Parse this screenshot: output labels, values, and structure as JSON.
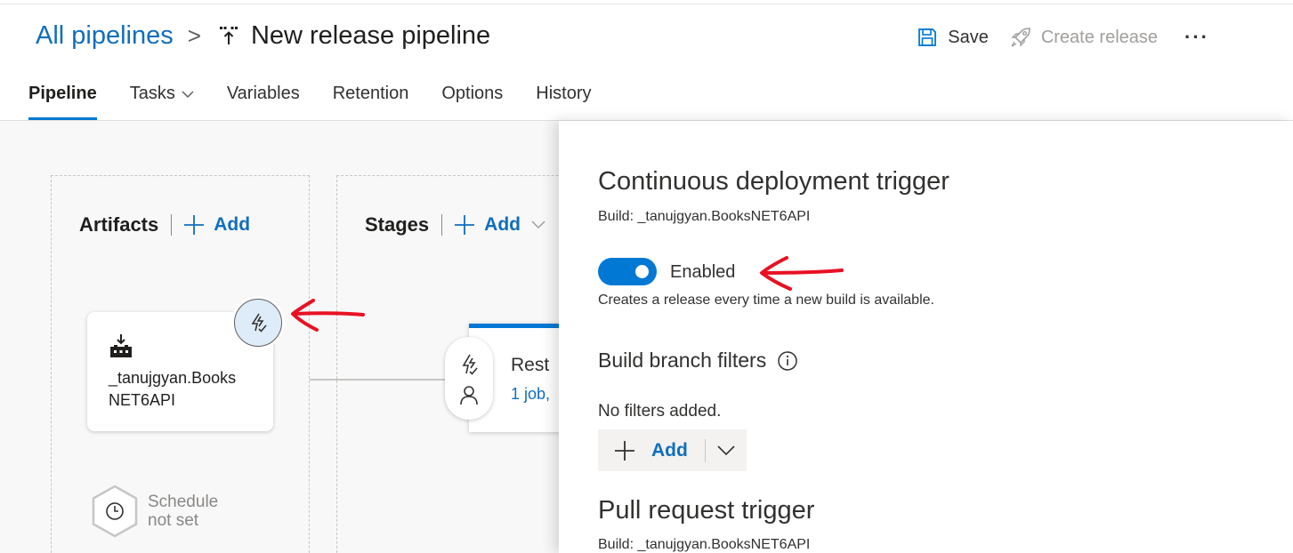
{
  "header": {
    "breadcrumb_root": "All pipelines",
    "breadcrumb_sep": ">",
    "title": "New release pipeline",
    "save_label": "Save",
    "create_release_label": "Create release",
    "more_label": "···"
  },
  "tabs": [
    {
      "label": "Pipeline",
      "active": true
    },
    {
      "label": "Tasks",
      "active": false
    },
    {
      "label": "Variables",
      "active": false
    },
    {
      "label": "Retention",
      "active": false
    },
    {
      "label": "Options",
      "active": false
    },
    {
      "label": "History",
      "active": false
    }
  ],
  "canvas": {
    "artifacts_title": "Artifacts",
    "artifacts_add": "Add",
    "stages_title": "Stages",
    "stages_add": "Add",
    "artifact_name_line1": "_tanujgyan.Books",
    "artifact_name_line2": "NET6API",
    "stage_name": "Rest",
    "stage_sub": "1 job,",
    "schedule_line1": "Schedule",
    "schedule_line2": "not set"
  },
  "panel": {
    "cd_title": "Continuous deployment trigger",
    "cd_build": "Build: _tanujgyan.BooksNET6API",
    "toggle_label": "Enabled",
    "toggle_on": true,
    "cd_description": "Creates a release every time a new build is available.",
    "branch_filters_title": "Build branch filters",
    "no_filters": "No filters added.",
    "add_label": "Add",
    "pr_title": "Pull request trigger",
    "pr_build": "Build: _tanujgyan.BooksNET6API"
  },
  "colors": {
    "accent": "#0078d4",
    "link": "#106ebe",
    "annotation_arrow": "#e81123",
    "badge_bg": "#deecf9"
  }
}
